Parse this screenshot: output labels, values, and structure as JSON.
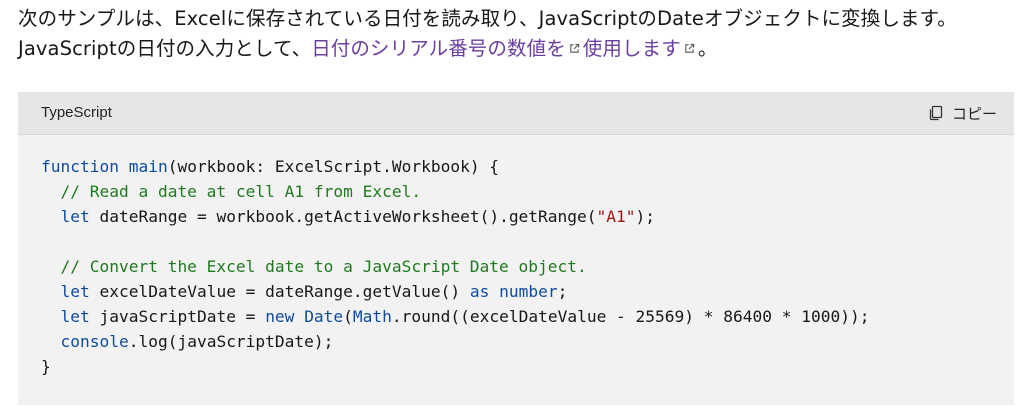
{
  "intro": {
    "text_before": "次のサンプルは、Excelに保存されている日付を読み取り、JavaScriptのDateオブジェクトに変換します。JavaScriptの日付の入力として、",
    "link1": "日付のシリアル番号の数値を",
    "link2": "使用します",
    "text_after": "。",
    "link_color": "#6b3fa0"
  },
  "code_block": {
    "language": "TypeScript",
    "copy_label": "コピー",
    "copy_icon": "copy-icon",
    "lines": [
      [
        [
          "function ",
          "kw"
        ],
        [
          "main",
          "fn"
        ],
        [
          "(workbook: ExcelScript.Workbook) {",
          ""
        ]
      ],
      [
        [
          "  // Read a date at cell A1 from Excel.",
          "cm"
        ]
      ],
      [
        [
          "  ",
          ""
        ],
        [
          "let",
          "kw"
        ],
        [
          " dateRange = workbook.getActiveWorksheet().getRange(",
          ""
        ],
        [
          "\"A1\"",
          "st"
        ],
        [
          ");",
          ""
        ]
      ],
      [
        [
          "",
          ""
        ]
      ],
      [
        [
          "  // Convert the Excel date to a JavaScript Date object.",
          "cm"
        ]
      ],
      [
        [
          "  ",
          ""
        ],
        [
          "let",
          "kw"
        ],
        [
          " excelDateValue = dateRange.getValue() ",
          ""
        ],
        [
          "as",
          "kw"
        ],
        [
          " ",
          ""
        ],
        [
          "number",
          "ty"
        ],
        [
          ";",
          ""
        ]
      ],
      [
        [
          "  ",
          ""
        ],
        [
          "let",
          "kw"
        ],
        [
          " javaScriptDate = ",
          ""
        ],
        [
          "new",
          "kw"
        ],
        [
          " ",
          ""
        ],
        [
          "Date",
          "ty"
        ],
        [
          "(",
          ""
        ],
        [
          "Math",
          "ty"
        ],
        [
          ".round((excelDateValue - 25569) * 86400 * 1000));",
          ""
        ]
      ],
      [
        [
          "  ",
          ""
        ],
        [
          "console",
          "ty"
        ],
        [
          ".log(javaScriptDate);",
          ""
        ]
      ],
      [
        [
          "}",
          ""
        ]
      ]
    ]
  }
}
